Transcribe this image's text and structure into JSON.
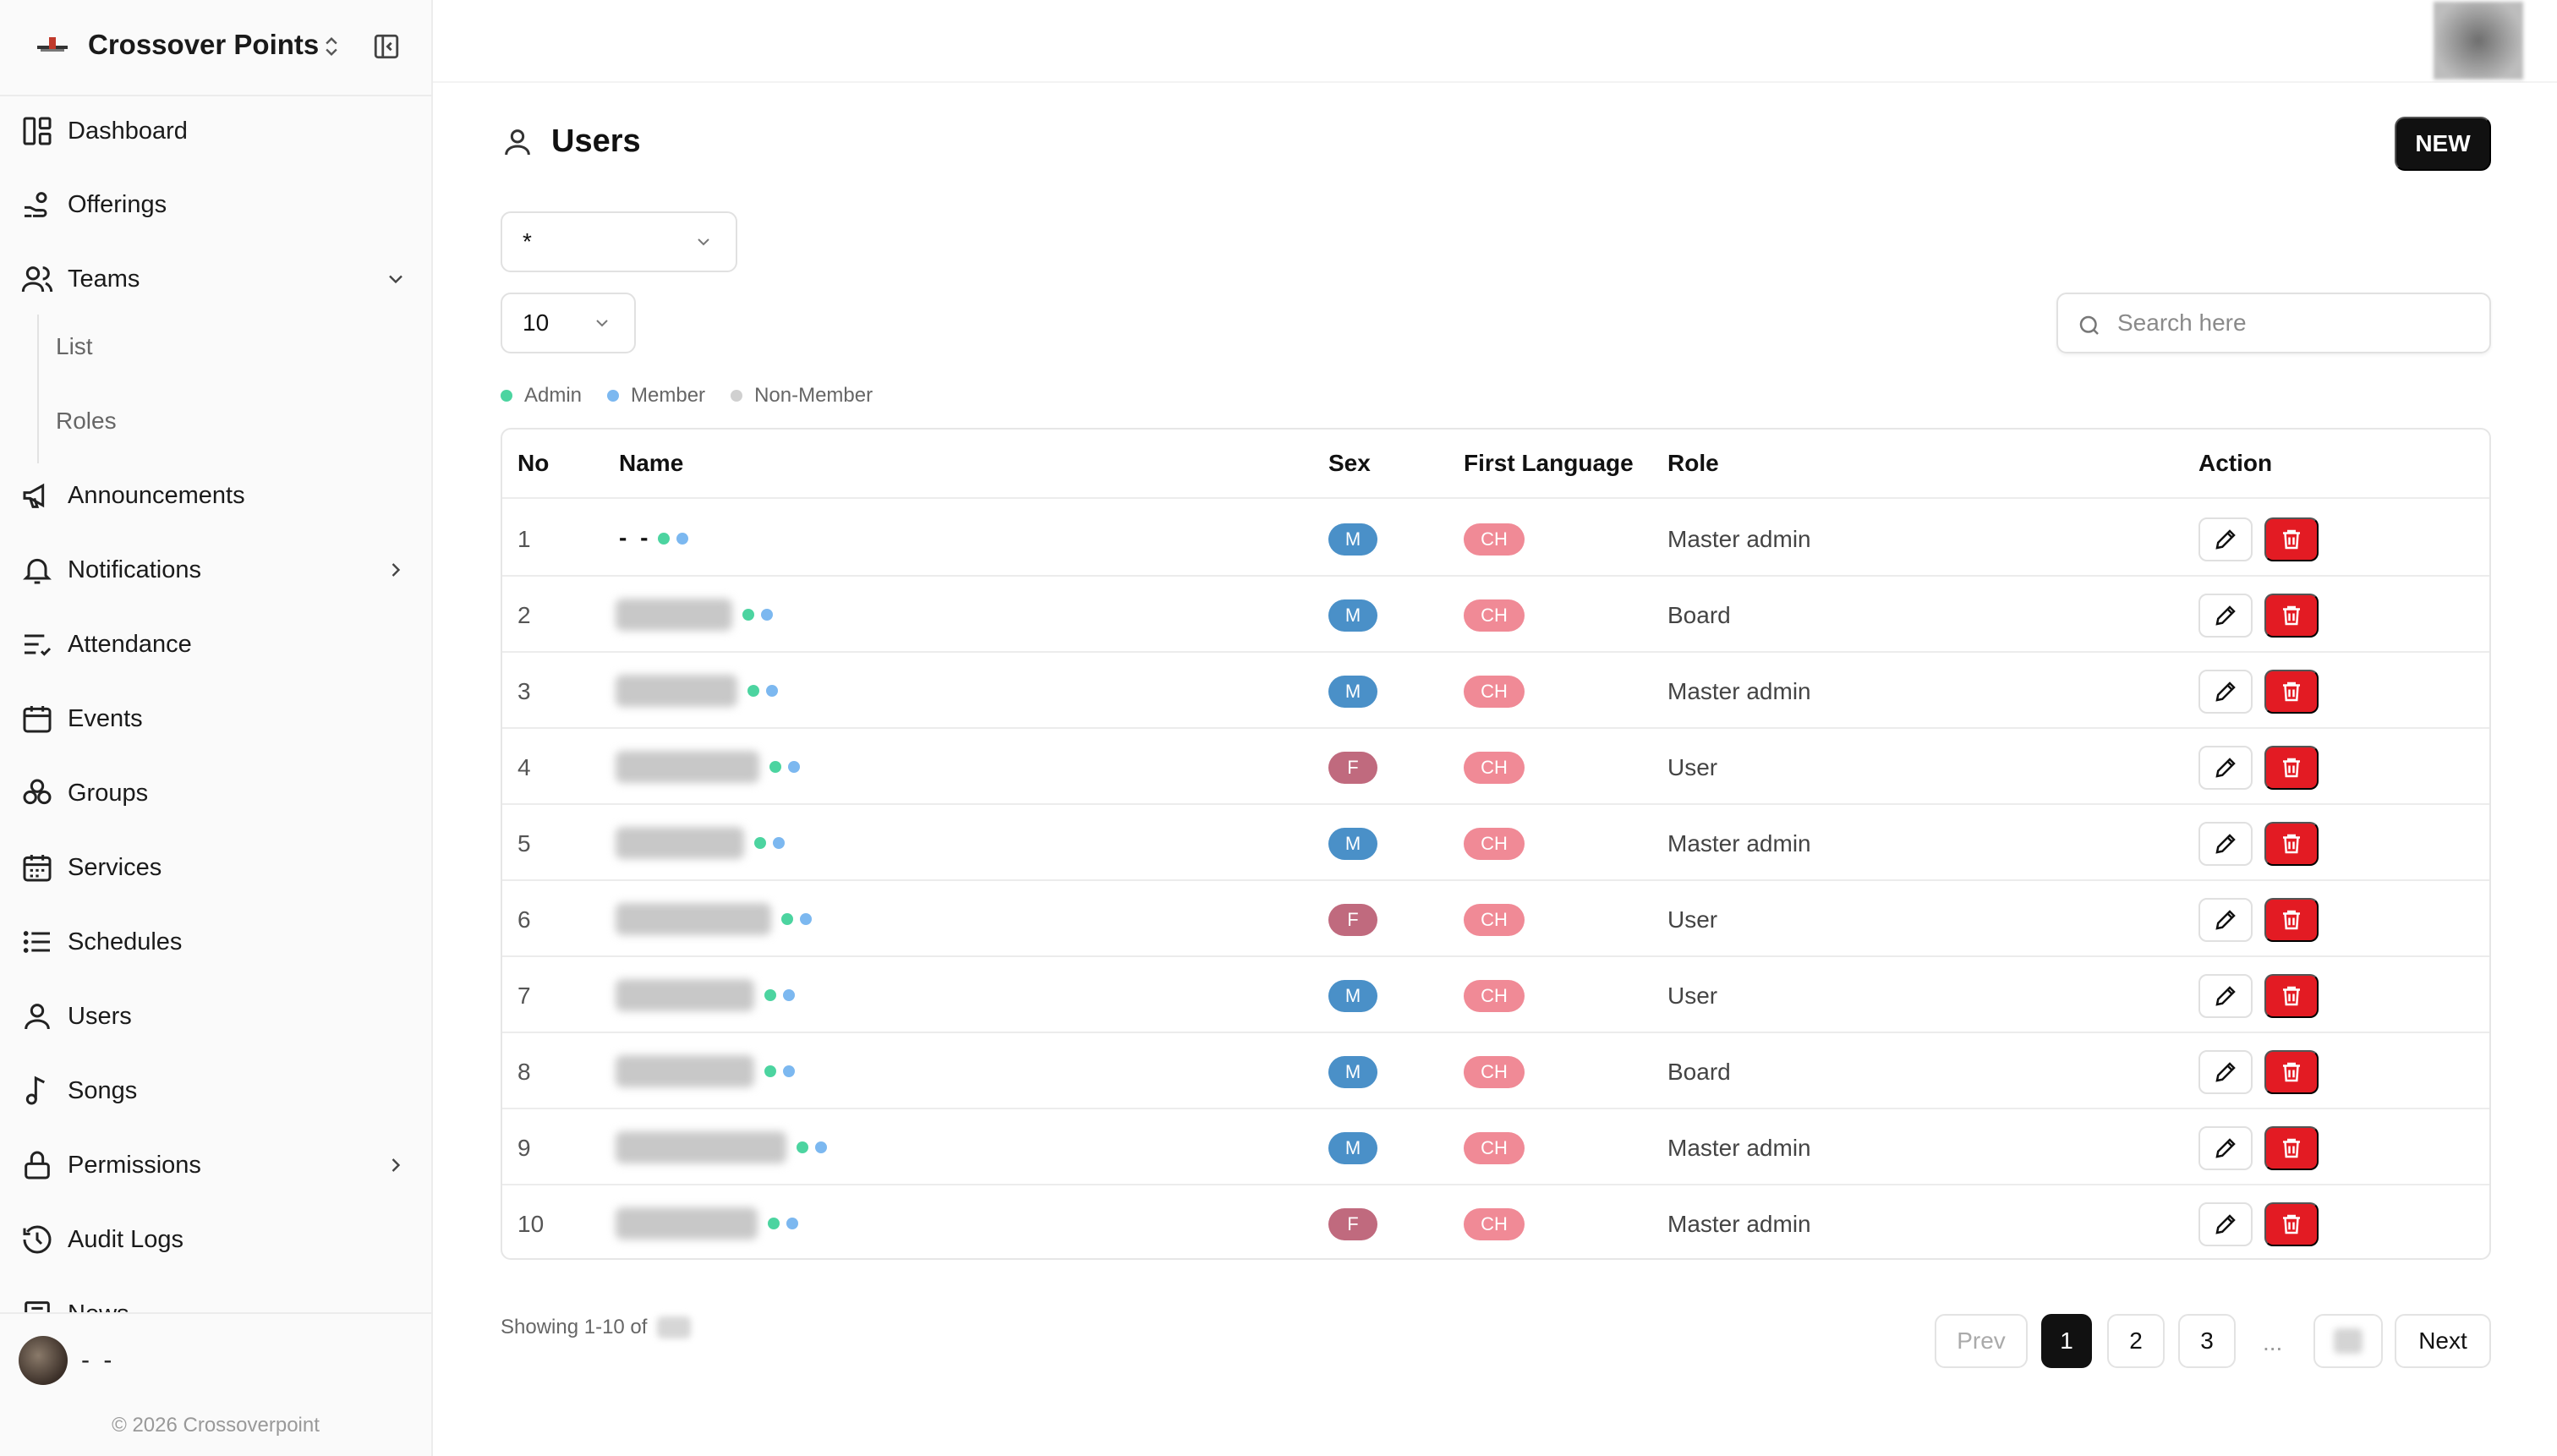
{
  "app": {
    "name": "Crossover Points",
    "copyright": "© 2026 Crossoverpoint",
    "current_user_name": "- -"
  },
  "sidebar": {
    "items": [
      {
        "label": "Dashboard",
        "icon": "dashboard-icon"
      },
      {
        "label": "Offerings",
        "icon": "hand-coins-icon"
      },
      {
        "label": "Teams",
        "icon": "users-icon",
        "expanded": true,
        "children": [
          "List",
          "Roles"
        ]
      },
      {
        "label": "Announcements",
        "icon": "megaphone-icon"
      },
      {
        "label": "Notifications",
        "icon": "bell-icon",
        "has_children": true
      },
      {
        "label": "Attendance",
        "icon": "list-check-icon"
      },
      {
        "label": "Events",
        "icon": "calendar-icon"
      },
      {
        "label": "Groups",
        "icon": "group-icon"
      },
      {
        "label": "Services",
        "icon": "calendar-grid-icon"
      },
      {
        "label": "Schedules",
        "icon": "list-icon"
      },
      {
        "label": "Users",
        "icon": "user-icon"
      },
      {
        "label": "Songs",
        "icon": "music-note-icon"
      },
      {
        "label": "Permissions",
        "icon": "lock-icon",
        "has_children": true
      },
      {
        "label": "Audit Logs",
        "icon": "history-icon"
      },
      {
        "label": "News",
        "icon": "newspaper-icon"
      }
    ]
  },
  "page": {
    "title": "Users",
    "new_button": "NEW",
    "filter_value": "*",
    "page_size": "10",
    "search_placeholder": "Search here"
  },
  "legend": [
    {
      "label": "Admin",
      "color": "#4cd4a0"
    },
    {
      "label": "Member",
      "color": "#7cb8f0"
    },
    {
      "label": "Non-Member",
      "color": "#d0d0d0"
    }
  ],
  "table": {
    "columns": [
      "No",
      "Name",
      "Sex",
      "First Language",
      "Role",
      "Action"
    ],
    "rows": [
      {
        "no": "1",
        "name": "- -",
        "sex": "M",
        "lang": "CH",
        "role": "Master admin"
      },
      {
        "no": "2",
        "name": "",
        "sex": "M",
        "lang": "CH",
        "role": "Board"
      },
      {
        "no": "3",
        "name": "",
        "sex": "M",
        "lang": "CH",
        "role": "Master admin"
      },
      {
        "no": "4",
        "name": "",
        "sex": "F",
        "lang": "CH",
        "role": "User"
      },
      {
        "no": "5",
        "name": "",
        "sex": "M",
        "lang": "CH",
        "role": "Master admin"
      },
      {
        "no": "6",
        "name": "",
        "sex": "F",
        "lang": "CH",
        "role": "User"
      },
      {
        "no": "7",
        "name": "",
        "sex": "M",
        "lang": "CH",
        "role": "User"
      },
      {
        "no": "8",
        "name": "",
        "sex": "M",
        "lang": "CH",
        "role": "Board"
      },
      {
        "no": "9",
        "name": "",
        "sex": "M",
        "lang": "CH",
        "role": "Master admin"
      },
      {
        "no": "10",
        "name": "",
        "sex": "F",
        "lang": "CH",
        "role": "Master admin"
      }
    ]
  },
  "colors": {
    "male_badge": "#4a90c8",
    "female_badge": "#c06a7e",
    "lang_badge": "#f08a96",
    "delete_button": "#e31b23",
    "primary_button": "#111111"
  },
  "pagination": {
    "showing": "Showing 1-10 of",
    "prev": "Prev",
    "pages": [
      "1",
      "2",
      "3"
    ],
    "ellipsis": "...",
    "next": "Next",
    "current": "1"
  }
}
